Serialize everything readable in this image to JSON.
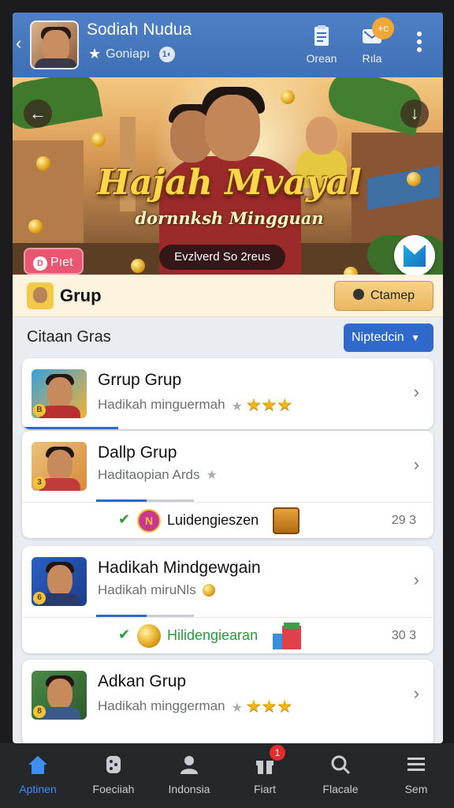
{
  "header": {
    "title": "Sodiah Nudua",
    "subtitle": "Goniapı",
    "subtitle_badge": "1◐",
    "buttons": [
      {
        "label": "Orean",
        "icon": "clipboard-icon"
      },
      {
        "label": "Rıla",
        "icon": "mail-icon"
      }
    ],
    "plus_badge": "+c"
  },
  "banner": {
    "title": "Hajah Mvayal",
    "subtitle": "dornnksh Mingguan",
    "pill": "Evzlverd So 2reus",
    "pret_label": "Pıet",
    "colors": {
      "title": "#ffd54a",
      "pret": "#e85672"
    }
  },
  "group": {
    "title": "Grup",
    "button": "Ctamep"
  },
  "filter": {
    "label": "Citaan Gras",
    "dropdown": "Niptedcin"
  },
  "cards": [
    {
      "title": "Grrup Grup",
      "subtitle": "Hadikah minguermah",
      "stars": 3,
      "progress": 0.23,
      "thumb_badge": "B"
    },
    {
      "title": "Dallp Grup",
      "subtitle": "Haditaopian Ards",
      "stars": 0,
      "thumb_badge": "3",
      "reward": {
        "label": "Luidengieszen",
        "count": "29 3",
        "progress": 0.5,
        "badge": "N"
      }
    },
    {
      "title": "Hadikah Mindgewgain",
      "subtitle": "Hadikah miruNls",
      "stars": 0,
      "thumb_badge": "6",
      "reward": {
        "label": "Hilidengiearan",
        "count": "30 3",
        "progress": 0.5
      }
    },
    {
      "title": "Adkan Grup",
      "subtitle": "Hadikah minggerman",
      "stars": 3,
      "thumb_badge": "8"
    }
  ],
  "tabs": [
    {
      "label": "Aptinen",
      "icon": "home-icon",
      "active": true
    },
    {
      "label": "Foeciiah",
      "icon": "dice-icon"
    },
    {
      "label": "Indonsia",
      "icon": "person-icon"
    },
    {
      "label": "Fiart",
      "icon": "gift-icon",
      "badge": "1"
    },
    {
      "label": "Flacale",
      "icon": "search-icon"
    },
    {
      "label": "Sem",
      "icon": "menu-icon"
    }
  ]
}
